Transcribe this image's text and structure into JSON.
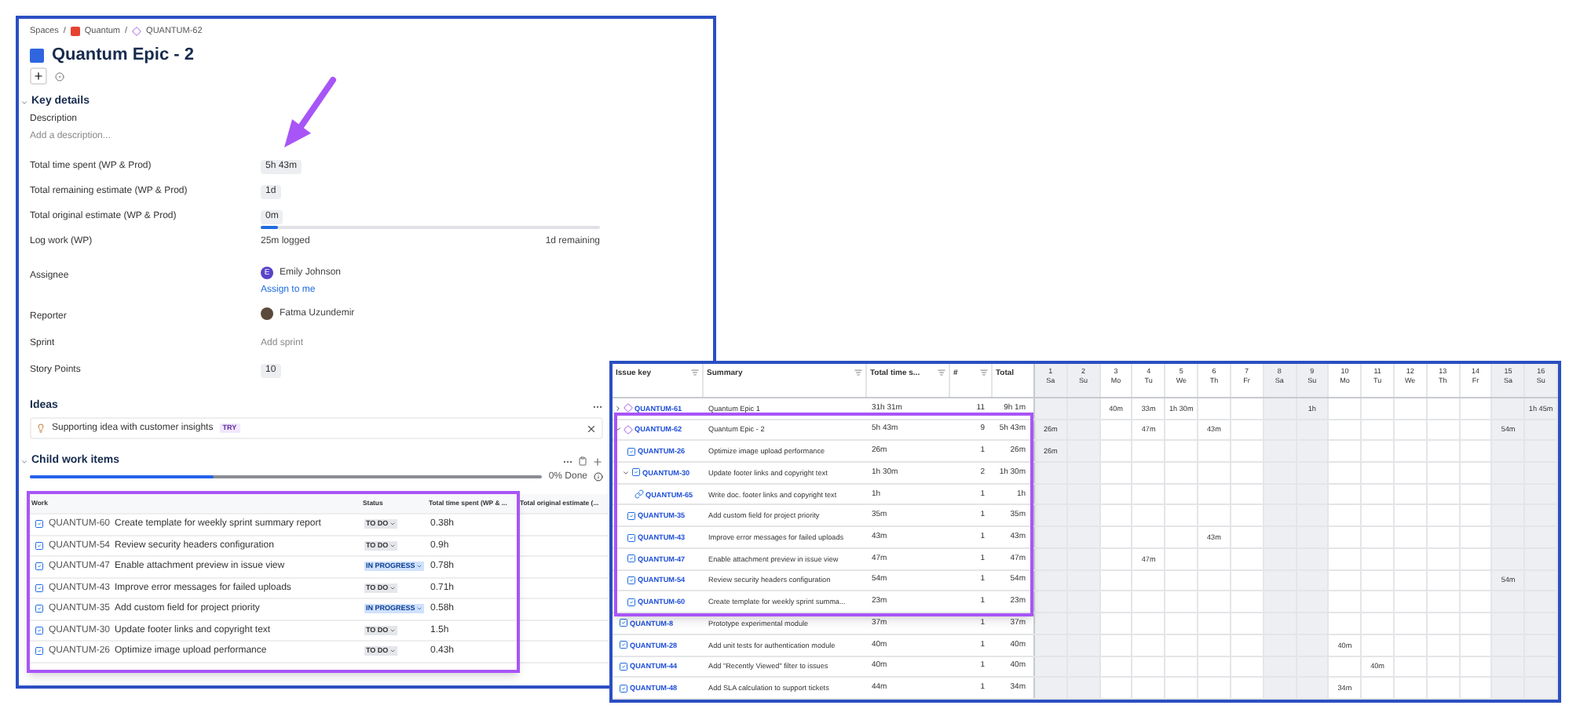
{
  "issue_view": {
    "breadcrumb": {
      "separator": "/",
      "items": [
        {
          "label": "Spaces",
          "kind": "text"
        },
        {
          "label": "Quantum",
          "kind": "project"
        },
        {
          "label": "QUANTUM-62",
          "kind": "epic"
        }
      ]
    },
    "title": "Quantum Epic - 2",
    "key_details": {
      "heading": "Key details",
      "expanded": true,
      "description_label": "Description",
      "description_placeholder": "Add a description...",
      "fields": [
        {
          "label": "Total time spent (WP & Prod)",
          "kind": "chip",
          "value": "5h 43m"
        },
        {
          "label": "Total remaining estimate (WP & Prod)",
          "kind": "chip",
          "value": "1d"
        },
        {
          "label": "Total original estimate (WP & Prod)",
          "kind": "chip",
          "value": "0m"
        },
        {
          "label": "Log work (WP)",
          "kind": "progress",
          "level": 0.05,
          "logged": "25m logged",
          "remaining": "1d remaining"
        },
        {
          "label": "Assignee",
          "kind": "user",
          "avatar": "E",
          "value": "Emily Johnson",
          "link": "Assign to me"
        },
        {
          "label": "Reporter",
          "kind": "user",
          "value": "Fatma Uzundemir"
        },
        {
          "label": "Sprint",
          "kind": "empty",
          "value": "Add sprint"
        },
        {
          "label": "Story Points",
          "kind": "chip",
          "value": "10"
        }
      ]
    },
    "ideas": {
      "heading": "Ideas",
      "items": [
        {
          "text": "Supporting idea with customer insights",
          "tag": "TRY"
        }
      ]
    },
    "child_work_items": {
      "heading": "Child work items",
      "expanded": true,
      "level": 0.36,
      "done": "0% Done",
      "columns": [
        "Work",
        "Status",
        "Total time spent (WP & ...",
        "Total original estimate (..."
      ],
      "rows": [
        {
          "key": "QUANTUM-60",
          "summary": "Create template for weekly sprint summary report",
          "status": "TO DO",
          "kind": "todo",
          "time": "0.38h"
        },
        {
          "key": "QUANTUM-54",
          "summary": "Review security headers configuration",
          "status": "TO DO",
          "kind": "todo",
          "time": "0.9h"
        },
        {
          "key": "QUANTUM-47",
          "summary": "Enable attachment preview in issue view",
          "status": "IN PROGRESS",
          "kind": "inprogress",
          "time": "0.78h"
        },
        {
          "key": "QUANTUM-43",
          "summary": "Improve error messages for failed uploads",
          "status": "TO DO",
          "kind": "todo",
          "time": "0.71h"
        },
        {
          "key": "QUANTUM-35",
          "summary": "Add custom field for project priority",
          "status": "IN PROGRESS",
          "kind": "inprogress",
          "time": "0.58h"
        },
        {
          "key": "QUANTUM-30",
          "summary": "Update footer links and copyright text",
          "status": "TO DO",
          "kind": "todo",
          "time": "1.5h"
        },
        {
          "key": "QUANTUM-26",
          "summary": "Optimize image upload performance",
          "status": "TO DO",
          "kind": "todo",
          "time": "0.43h"
        }
      ]
    }
  },
  "timesheet": {
    "columns": [
      {
        "label": "Issue key",
        "filter": true
      },
      {
        "label": "Summary",
        "filter": true
      },
      {
        "label": "Total time s...",
        "filter": true
      },
      {
        "label": "#",
        "filter": true
      },
      {
        "label": "Total",
        "filter": false
      }
    ],
    "days": [
      {
        "num": "1",
        "weekday": "Sa",
        "shaded": true
      },
      {
        "num": "2",
        "weekday": "Su",
        "shaded": true
      },
      {
        "num": "3",
        "weekday": "Mo",
        "shaded": false
      },
      {
        "num": "4",
        "weekday": "Tu",
        "shaded": false
      },
      {
        "num": "5",
        "weekday": "We",
        "shaded": false
      },
      {
        "num": "6",
        "weekday": "Th",
        "shaded": false
      },
      {
        "num": "7",
        "weekday": "Fr",
        "shaded": false
      },
      {
        "num": "8",
        "weekday": "Sa",
        "shaded": true
      },
      {
        "num": "9",
        "weekday": "Su",
        "shaded": true
      },
      {
        "num": "10",
        "weekday": "Mo",
        "shaded": false
      },
      {
        "num": "11",
        "weekday": "Tu",
        "shaded": false
      },
      {
        "num": "12",
        "weekday": "We",
        "shaded": false
      },
      {
        "num": "13",
        "weekday": "Th",
        "shaded": false
      },
      {
        "num": "14",
        "weekday": "Fr",
        "shaded": false
      },
      {
        "num": "15",
        "weekday": "Sa",
        "shaded": true
      },
      {
        "num": "16",
        "weekday": "Su",
        "shaded": true
      }
    ],
    "rows": [
      {
        "key": "QUANTUM-61",
        "kind": "epic",
        "expanded": false,
        "summary": "Quantum Epic 1",
        "time": "31h 31m",
        "count": "11",
        "total": "9h 1m",
        "cells": [
          null,
          null,
          "40m",
          "33m",
          "1h 30m",
          null,
          null,
          null,
          "1h",
          null,
          null,
          null,
          null,
          null,
          null,
          "1h 45m"
        ]
      },
      {
        "key": "QUANTUM-62",
        "kind": "epic",
        "expanded": true,
        "summary": "Quantum Epic - 2",
        "time": "5h 43m",
        "count": "9",
        "total": "5h 43m",
        "cells": [
          "26m",
          null,
          null,
          "47m",
          null,
          "43m",
          null,
          null,
          null,
          null,
          null,
          null,
          null,
          null,
          "54m",
          null
        ],
        "children": [
          {
            "key": "QUANTUM-26",
            "kind": "task",
            "summary": "Optimize image upload performance",
            "time": "26m",
            "count": "1",
            "total": "26m",
            "cells": [
              "26m",
              null,
              null,
              null,
              null,
              null,
              null,
              null,
              null,
              null,
              null,
              null,
              null,
              null,
              null,
              null
            ]
          },
          {
            "key": "QUANTUM-30",
            "kind": "task",
            "expanded": true,
            "summary": "Update footer links and copyright text",
            "time": "1h 30m",
            "count": "2",
            "total": "1h 30m",
            "cells": [
              null,
              null,
              null,
              null,
              null,
              null,
              null,
              null,
              null,
              null,
              null,
              null,
              null,
              null,
              null,
              null
            ],
            "children": [
              {
                "key": "QUANTUM-65",
                "kind": "subtask",
                "summary": "Write doc. footer links and copyright text",
                "time": "1h",
                "count": "1",
                "total": "1h",
                "cells": [
                  null,
                  null,
                  null,
                  null,
                  null,
                  null,
                  null,
                  null,
                  null,
                  null,
                  null,
                  null,
                  null,
                  null,
                  null,
                  null
                ]
              }
            ]
          },
          {
            "key": "QUANTUM-35",
            "kind": "task",
            "summary": "Add custom field for project priority",
            "time": "35m",
            "count": "1",
            "total": "35m",
            "cells": [
              null,
              null,
              null,
              null,
              null,
              null,
              null,
              null,
              null,
              null,
              null,
              null,
              null,
              null,
              null,
              null
            ]
          },
          {
            "key": "QUANTUM-43",
            "kind": "task",
            "summary": "Improve error messages for failed uploads",
            "time": "43m",
            "count": "1",
            "total": "43m",
            "cells": [
              null,
              null,
              null,
              null,
              null,
              "43m",
              null,
              null,
              null,
              null,
              null,
              null,
              null,
              null,
              null,
              null
            ]
          },
          {
            "key": "QUANTUM-47",
            "kind": "task",
            "summary": "Enable attachment preview in issue view",
            "time": "47m",
            "count": "1",
            "total": "47m",
            "cells": [
              null,
              null,
              null,
              "47m",
              null,
              null,
              null,
              null,
              null,
              null,
              null,
              null,
              null,
              null,
              null,
              null
            ]
          },
          {
            "key": "QUANTUM-54",
            "kind": "task",
            "summary": "Review security headers configuration",
            "time": "54m",
            "count": "1",
            "total": "54m",
            "cells": [
              null,
              null,
              null,
              null,
              null,
              null,
              null,
              null,
              null,
              null,
              null,
              null,
              null,
              null,
              "54m",
              null
            ]
          },
          {
            "key": "QUANTUM-60",
            "kind": "task",
            "summary": "Create template for weekly sprint summa...",
            "time": "23m",
            "count": "1",
            "total": "23m",
            "cells": [
              null,
              null,
              null,
              null,
              null,
              null,
              null,
              null,
              null,
              null,
              null,
              null,
              null,
              null,
              null,
              null
            ]
          }
        ]
      },
      {
        "key": "QUANTUM-8",
        "kind": "task",
        "summary": "Prototype experimental module",
        "time": "37m",
        "count": "1",
        "total": "37m",
        "cells": [
          null,
          null,
          null,
          null,
          null,
          null,
          null,
          null,
          null,
          null,
          null,
          null,
          null,
          null,
          null,
          null
        ]
      },
      {
        "key": "QUANTUM-28",
        "kind": "task",
        "summary": "Add unit tests for authentication module",
        "time": "40m",
        "count": "1",
        "total": "40m",
        "cells": [
          null,
          null,
          null,
          null,
          null,
          null,
          null,
          null,
          null,
          "40m",
          null,
          null,
          null,
          null,
          null,
          null
        ]
      },
      {
        "key": "QUANTUM-44",
        "kind": "task",
        "summary": "Add \"Recently Viewed\" filter to issues",
        "time": "40m",
        "count": "1",
        "total": "40m",
        "cells": [
          null,
          null,
          null,
          null,
          null,
          null,
          null,
          null,
          null,
          null,
          "40m",
          null,
          null,
          null,
          null,
          null
        ]
      },
      {
        "key": "QUANTUM-48",
        "kind": "task",
        "summary": "Add SLA calculation to support tickets",
        "time": "44m",
        "count": "1",
        "total": "34m",
        "cells": [
          null,
          null,
          null,
          null,
          null,
          null,
          null,
          null,
          null,
          "34m",
          null,
          null,
          null,
          null,
          null,
          null
        ]
      }
    ]
  }
}
